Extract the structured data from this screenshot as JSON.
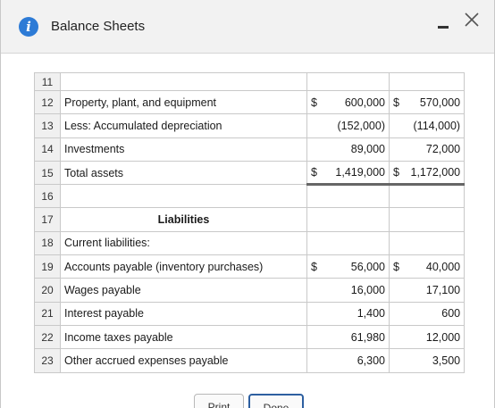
{
  "dialog": {
    "title": "Balance Sheets",
    "info_icon": "i",
    "minimize_icon": "minimize-icon",
    "close_icon": "close-icon"
  },
  "rows": [
    {
      "num": "11",
      "label": "",
      "c1sym": "",
      "c1": "",
      "c2sym": "",
      "c2": ""
    },
    {
      "num": "12",
      "label": "Property, plant, and equipment",
      "c1sym": "$",
      "c1": "600,000",
      "c2sym": "$",
      "c2": "570,000"
    },
    {
      "num": "13",
      "label": "Less: Accumulated depreciation",
      "c1sym": "",
      "c1": "(152,000)",
      "c2sym": "",
      "c2": "(114,000)"
    },
    {
      "num": "14",
      "label": "Investments",
      "c1sym": "",
      "c1": "89,000",
      "c2sym": "",
      "c2": "72,000"
    },
    {
      "num": "15",
      "label": "Total assets",
      "c1sym": "$",
      "c1": "1,419,000",
      "c2sym": "$",
      "c2": "1,172,000"
    },
    {
      "num": "16",
      "label": "",
      "c1sym": "",
      "c1": "",
      "c2sym": "",
      "c2": ""
    },
    {
      "num": "17",
      "label": "Liabilities",
      "c1sym": "",
      "c1": "",
      "c2sym": "",
      "c2": ""
    },
    {
      "num": "18",
      "label": "Current liabilities:",
      "c1sym": "",
      "c1": "",
      "c2sym": "",
      "c2": ""
    },
    {
      "num": "19",
      "label": "Accounts payable (inventory purchases)",
      "c1sym": "$",
      "c1": "56,000",
      "c2sym": "$",
      "c2": "40,000"
    },
    {
      "num": "20",
      "label": "Wages payable",
      "c1sym": "",
      "c1": "16,000",
      "c2sym": "",
      "c2": "17,100"
    },
    {
      "num": "21",
      "label": "Interest payable",
      "c1sym": "",
      "c1": "1,400",
      "c2sym": "",
      "c2": "600"
    },
    {
      "num": "22",
      "label": "Income taxes payable",
      "c1sym": "",
      "c1": "61,980",
      "c2sym": "",
      "c2": "12,000"
    },
    {
      "num": "23",
      "label": "Other accrued expenses payable",
      "c1sym": "",
      "c1": "6,300",
      "c2sym": "",
      "c2": "3,500"
    }
  ],
  "buttons": {
    "print": "Print",
    "done": "Done"
  }
}
